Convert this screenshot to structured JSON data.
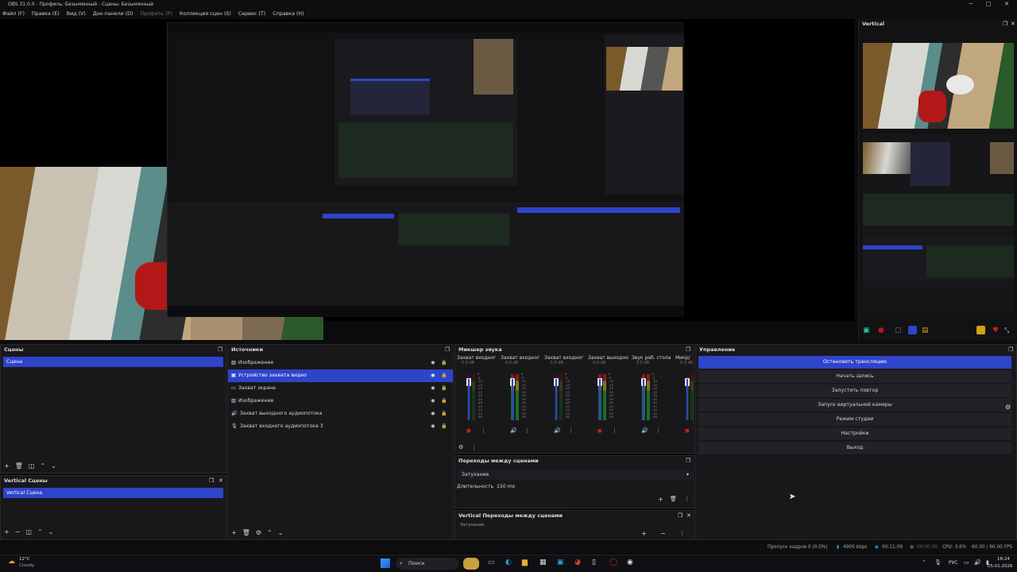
{
  "window": {
    "title": "OBS 31.0.0 - Профиль: Безымянный - Сцены: Безымянный"
  },
  "menu": [
    {
      "label": "Файл (F)",
      "dim": false
    },
    {
      "label": "Правка (E)",
      "dim": false
    },
    {
      "label": "Вид (V)",
      "dim": false
    },
    {
      "label": "Док-панели (D)",
      "dim": false
    },
    {
      "label": "Профиль (P)",
      "dim": true
    },
    {
      "label": "Коллекция сцен (S)",
      "dim": false
    },
    {
      "label": "Сервис (T)",
      "dim": false
    },
    {
      "label": "Справка (H)",
      "dim": false
    }
  ],
  "vertical_panel": {
    "title": "Vertical"
  },
  "scenes": {
    "title": "Сцены",
    "items": [
      "Сцена"
    ],
    "selected": 0
  },
  "vertical_scenes": {
    "title": "Vertical Сцены",
    "items": [
      "Vertical Сцена"
    ]
  },
  "sources": {
    "title": "Источники",
    "items": [
      {
        "label": "Изображение",
        "icon": "image-icon"
      },
      {
        "label": "Устройство захвата видео",
        "icon": "camera-icon",
        "selected": true
      },
      {
        "label": "Захват экрана",
        "icon": "monitor-icon"
      },
      {
        "label": "Изображение",
        "icon": "image-icon"
      },
      {
        "label": "Захват выходного аудиопотока",
        "icon": "speaker-icon"
      },
      {
        "label": "Захват входного аудиопотока 3",
        "icon": "mic-icon"
      }
    ]
  },
  "mixer": {
    "title": "Микшер звука",
    "channels": [
      {
        "name": "Захват входног",
        "db": "0.0 dB",
        "level": 0.15,
        "muted": true
      },
      {
        "name": "Захват входног",
        "db": "0.0 dB",
        "level": 0.55,
        "muted": false
      },
      {
        "name": "Захват входног",
        "db": "-5.5 dB",
        "level": 0.1,
        "muted": false
      },
      {
        "name": "Захват выходно",
        "db": "0.0 dB",
        "level": 0.6,
        "muted": true
      },
      {
        "name": "Звук раб. стола",
        "db": "0.0 dB",
        "level": 0.55,
        "muted": false
      },
      {
        "name": "Микр/",
        "db": "0.0 dB",
        "level": 0.2,
        "muted": true
      }
    ],
    "scale": [
      "0",
      "-5",
      "-10",
      "-15",
      "-20",
      "-25",
      "-30",
      "-35",
      "-40",
      "-45",
      "-50",
      "-55",
      "-60"
    ]
  },
  "transitions": {
    "title": "Переходы между сценами",
    "type": "Затухание",
    "duration_label": "Длительность",
    "duration": "150 ms"
  },
  "vertical_transitions": {
    "title": "Vertical Переходы между сценами",
    "type": "Затухание"
  },
  "controls": {
    "title": "Управление",
    "buttons": [
      {
        "label": "Остановить трансляцию",
        "active": true
      },
      {
        "label": "Начать запись",
        "active": false
      },
      {
        "label": "Запустить повтор",
        "active": false
      },
      {
        "label": "Запуск виртуальной камеры",
        "active": false
      },
      {
        "label": "Режим студии",
        "active": false
      },
      {
        "label": "Настройки",
        "active": false
      },
      {
        "label": "Выход",
        "active": false
      }
    ]
  },
  "statusbar": {
    "dropped": "Пропуск кадров 0 (0.0%)",
    "bitrate": "4900 kbps",
    "stream_time": "00:11:09",
    "rec_time": "00:00:00",
    "cpu": "CPU: 3.6%",
    "fps": "60.00 / 60.00 FPS"
  },
  "taskbar": {
    "temp": "12°C",
    "weather": "Cloudy",
    "search": "Поиск",
    "lang": "РУС",
    "time": "18:24",
    "date": "05.01.2026"
  },
  "colors": {
    "accent": "#2e44c9",
    "panel": "#18181b",
    "bg": "#0b0b0d"
  }
}
